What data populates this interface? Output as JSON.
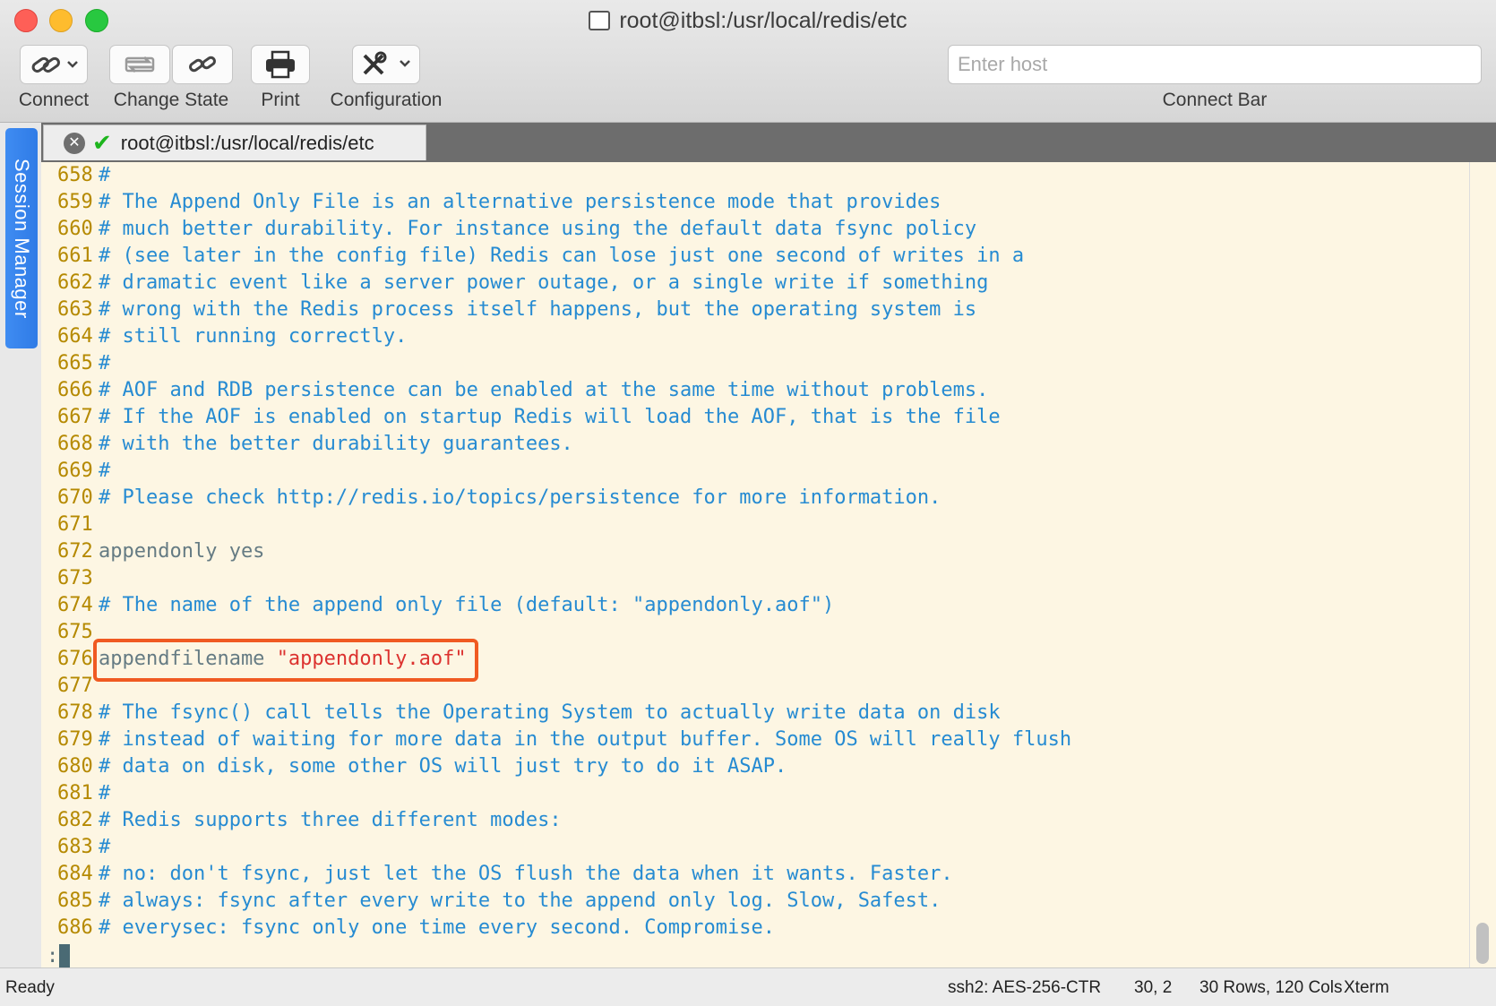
{
  "window": {
    "title": "root@itbsl:/usr/local/redis/etc"
  },
  "toolbar": {
    "connect_label": "Connect",
    "change_state_label": "Change State",
    "print_label": "Print",
    "configuration_label": "Configuration",
    "host_placeholder": "Enter host",
    "connect_bar_label": "Connect Bar"
  },
  "sidebar": {
    "session_manager_label": "Session Manager"
  },
  "tab": {
    "label": "root@itbsl:/usr/local/redis/etc"
  },
  "terminal": {
    "lines": [
      {
        "n": "658",
        "t": "#",
        "k": "cm"
      },
      {
        "n": "659",
        "t": "# The Append Only File is an alternative persistence mode that provides",
        "k": "cm"
      },
      {
        "n": "660",
        "t": "# much better durability. For instance using the default data fsync policy",
        "k": "cm"
      },
      {
        "n": "661",
        "t": "# (see later in the config file) Redis can lose just one second of writes in a",
        "k": "cm"
      },
      {
        "n": "662",
        "t": "# dramatic event like a server power outage, or a single write if something",
        "k": "cm"
      },
      {
        "n": "663",
        "t": "# wrong with the Redis process itself happens, but the operating system is",
        "k": "cm"
      },
      {
        "n": "664",
        "t": "# still running correctly.",
        "k": "cm"
      },
      {
        "n": "665",
        "t": "#",
        "k": "cm"
      },
      {
        "n": "666",
        "t": "# AOF and RDB persistence can be enabled at the same time without problems.",
        "k": "cm"
      },
      {
        "n": "667",
        "t": "# If the AOF is enabled on startup Redis will load the AOF, that is the file",
        "k": "cm"
      },
      {
        "n": "668",
        "t": "# with the better durability guarantees.",
        "k": "cm"
      },
      {
        "n": "669",
        "t": "#",
        "k": "cm"
      },
      {
        "n": "670",
        "t": "# Please check http://redis.io/topics/persistence for more information.",
        "k": "cm"
      },
      {
        "n": "671",
        "t": "",
        "k": "tx"
      },
      {
        "n": "672",
        "t": "appendonly yes",
        "k": "tx"
      },
      {
        "n": "673",
        "t": "",
        "k": "tx"
      },
      {
        "n": "674",
        "t": "# The name of the append only file (default: \"appendonly.aof\")",
        "k": "cm"
      },
      {
        "n": "675",
        "t": "",
        "k": "tx"
      },
      {
        "n": "676",
        "t": "appendfilename ",
        "k": "tx",
        "s": "\"appendonly.aof\""
      },
      {
        "n": "677",
        "t": "",
        "k": "tx"
      },
      {
        "n": "678",
        "t": "# The fsync() call tells the Operating System to actually write data on disk",
        "k": "cm"
      },
      {
        "n": "679",
        "t": "# instead of waiting for more data in the output buffer. Some OS will really flush",
        "k": "cm"
      },
      {
        "n": "680",
        "t": "# data on disk, some other OS will just try to do it ASAP.",
        "k": "cm"
      },
      {
        "n": "681",
        "t": "#",
        "k": "cm"
      },
      {
        "n": "682",
        "t": "# Redis supports three different modes:",
        "k": "cm"
      },
      {
        "n": "683",
        "t": "#",
        "k": "cm"
      },
      {
        "n": "684",
        "t": "# no: don't fsync, just let the OS flush the data when it wants. Faster.",
        "k": "cm"
      },
      {
        "n": "685",
        "t": "# always: fsync after every write to the append only log. Slow, Safest.",
        "k": "cm"
      },
      {
        "n": "686",
        "t": "# everysec: fsync only one time every second. Compromise.",
        "k": "cm"
      }
    ],
    "prompt": ":"
  },
  "status": {
    "left": "Ready",
    "cipher": "ssh2: AES-256-CTR",
    "position": "30, 2",
    "size": "30 Rows, 120 Cols",
    "emulation": "Xterm"
  }
}
